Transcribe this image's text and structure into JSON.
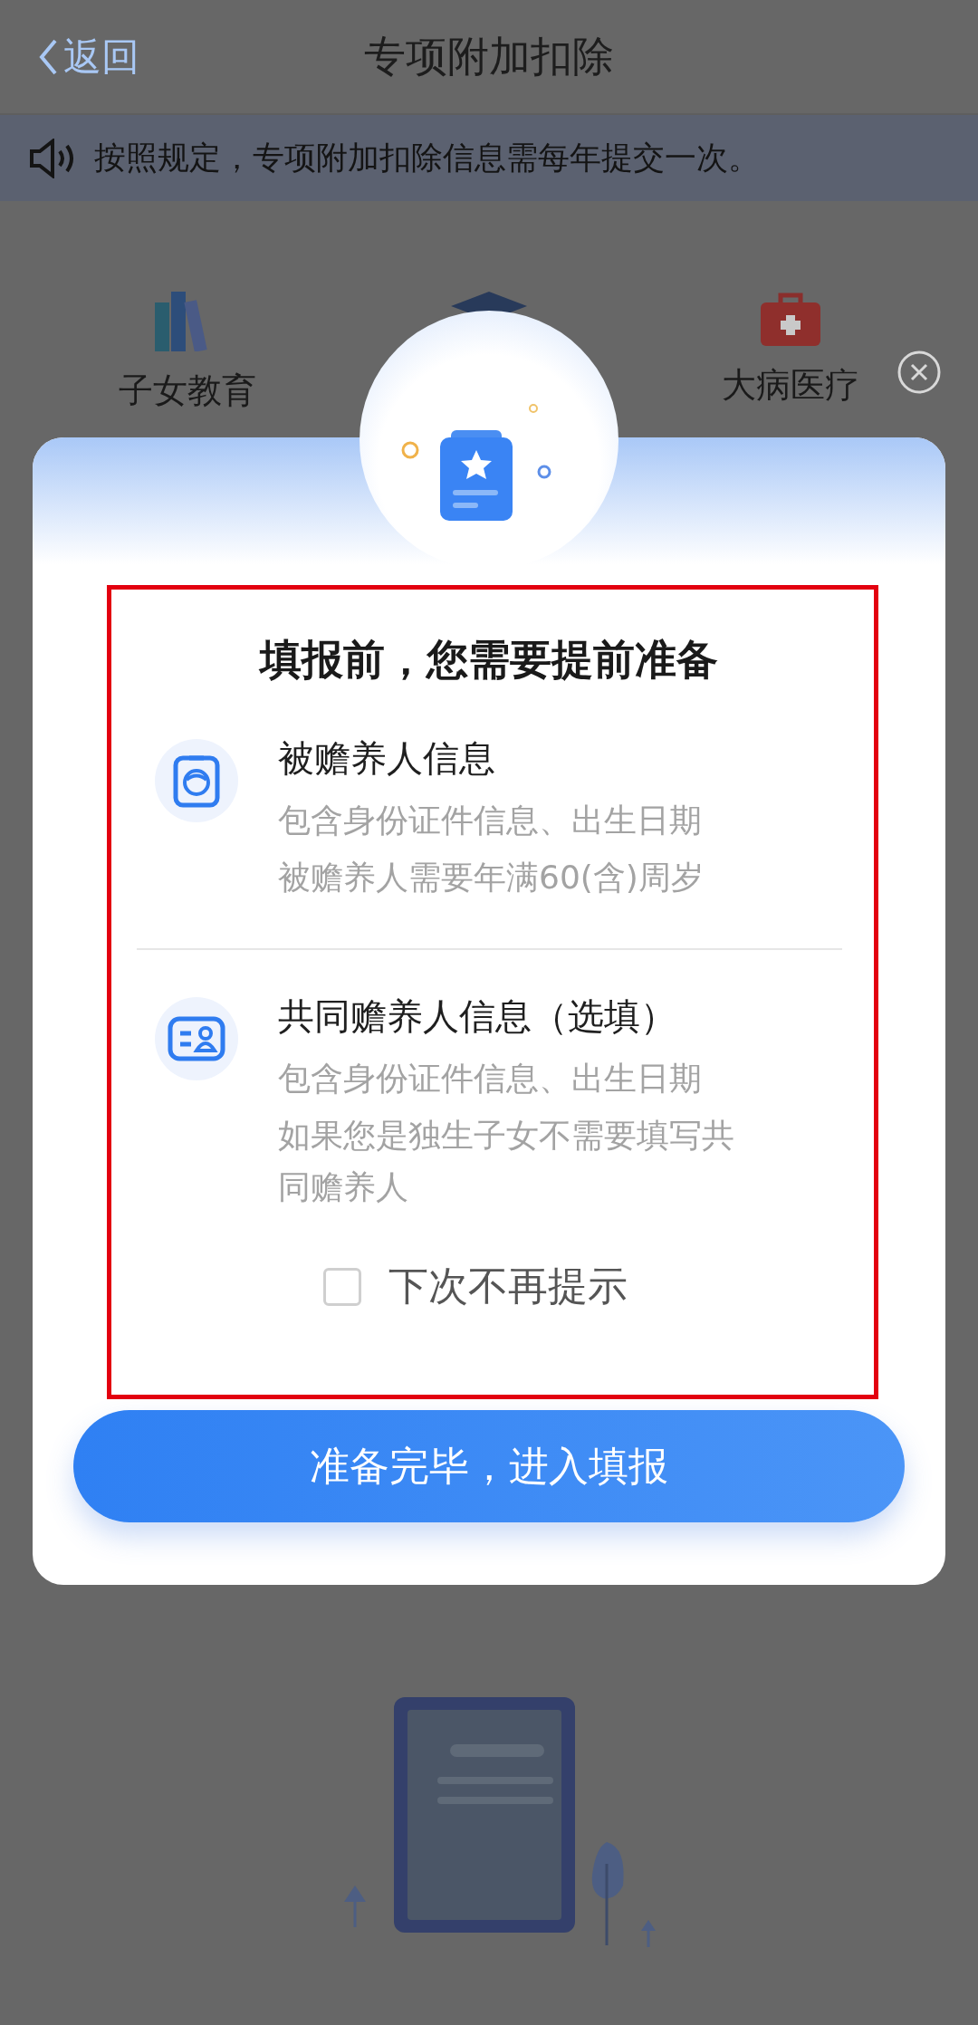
{
  "header": {
    "back_label": "返回",
    "title": "专项附加扣除"
  },
  "notice": "按照规定，专项附加扣除信息需每年提交一次。",
  "categories": [
    {
      "kind": "books",
      "label": "子女教育"
    },
    {
      "kind": "cap"
    },
    {
      "kind": "medkit",
      "label": "大病医疗"
    }
  ],
  "dialog": {
    "title": "填报前，您需要提前准备",
    "items": [
      {
        "kind": "badge",
        "title": "被赡养人信息",
        "lines": [
          "包含身份证件信息、出生日期",
          "被赡养人需要年满60(含)周岁"
        ]
      },
      {
        "kind": "card",
        "title": "共同赡养人信息（选填）",
        "lines": [
          "包含身份证件信息、出生日期",
          "如果您是独生子女不需要填写共同赡养人"
        ]
      }
    ],
    "checkbox": {
      "label": "下次不再提示",
      "checked": false
    },
    "button": "准备完毕，进入填报"
  }
}
